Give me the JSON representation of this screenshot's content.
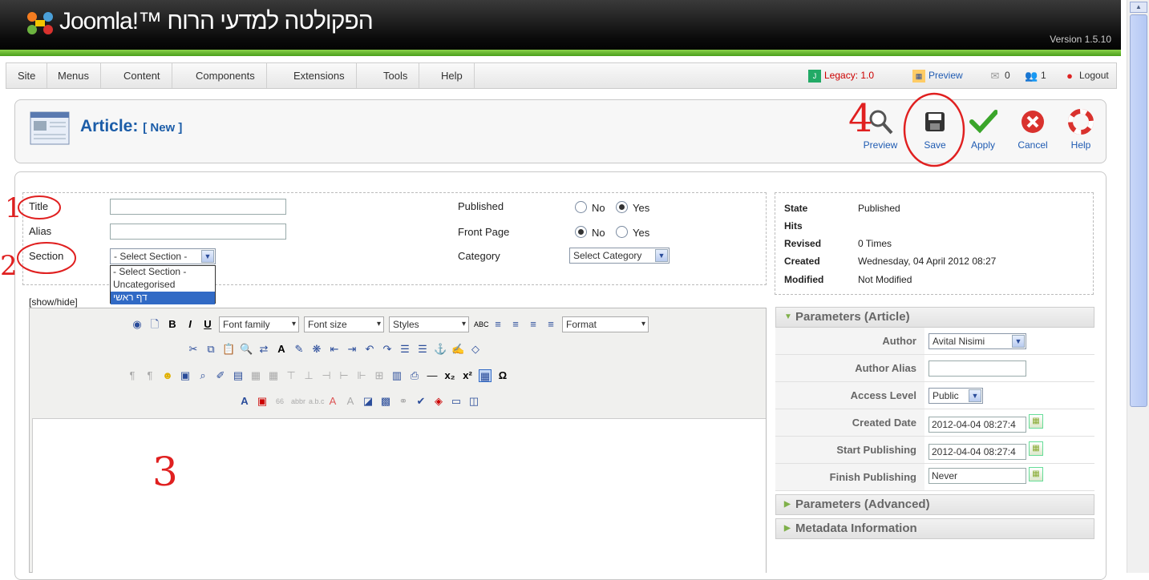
{
  "header": {
    "site_name": "Joomla!™ הפקולטה למדעי הרוח",
    "version": "Version 1.5.10"
  },
  "menu": {
    "items": [
      "Site",
      "Menus",
      "Content",
      "Components",
      "Extensions",
      "Tools",
      "Help"
    ]
  },
  "status": {
    "legacy": "Legacy: 1.0",
    "preview": "Preview",
    "messages": "0",
    "users": "1",
    "logout": "Logout"
  },
  "page": {
    "title": "Article:",
    "subtitle": "[ New ]"
  },
  "toolbar": {
    "preview": "Preview",
    "save": "Save",
    "apply": "Apply",
    "cancel": "Cancel",
    "help": "Help"
  },
  "form": {
    "title_label": "Title",
    "alias_label": "Alias",
    "section_label": "Section",
    "section_selected": "- Select Section -",
    "section_options": [
      "- Select Section -",
      "Uncategorised",
      "דף ראשי"
    ],
    "published_label": "Published",
    "frontpage_label": "Front Page",
    "category_label": "Category",
    "no": "No",
    "yes": "Yes",
    "category_selected": "Select Category"
  },
  "editor": {
    "showhide": "[show/hide]",
    "font_family": "Font family",
    "font_size": "Font size",
    "styles": "Styles",
    "format": "Format"
  },
  "state": {
    "state_label": "State",
    "state_value": "Published",
    "hits_label": "Hits",
    "revised_label": "Revised",
    "revised_value": "0 Times",
    "created_label": "Created",
    "created_value": "Wednesday, 04 April 2012 08:27",
    "modified_label": "Modified",
    "modified_value": "Not Modified"
  },
  "params": {
    "title": "Parameters (Article)",
    "author_label": "Author",
    "author_value": "Avital Nisimi",
    "alias_label": "Author Alias",
    "access_label": "Access Level",
    "access_value": "Public",
    "created_label": "Created Date",
    "created_value": "2012-04-04 08:27:4",
    "start_label": "Start Publishing",
    "start_value": "2012-04-04 08:27:4",
    "finish_label": "Finish Publishing",
    "finish_value": "Never"
  },
  "panels": {
    "advanced": "Parameters (Advanced)",
    "metadata": "Metadata Information"
  },
  "annotations": {
    "one": "1",
    "two": "2",
    "three": "3",
    "four": "4"
  },
  "colors": {
    "accent": "#1c5da8",
    "green_bar": "#5fb52a",
    "annotation": "#e02020"
  }
}
